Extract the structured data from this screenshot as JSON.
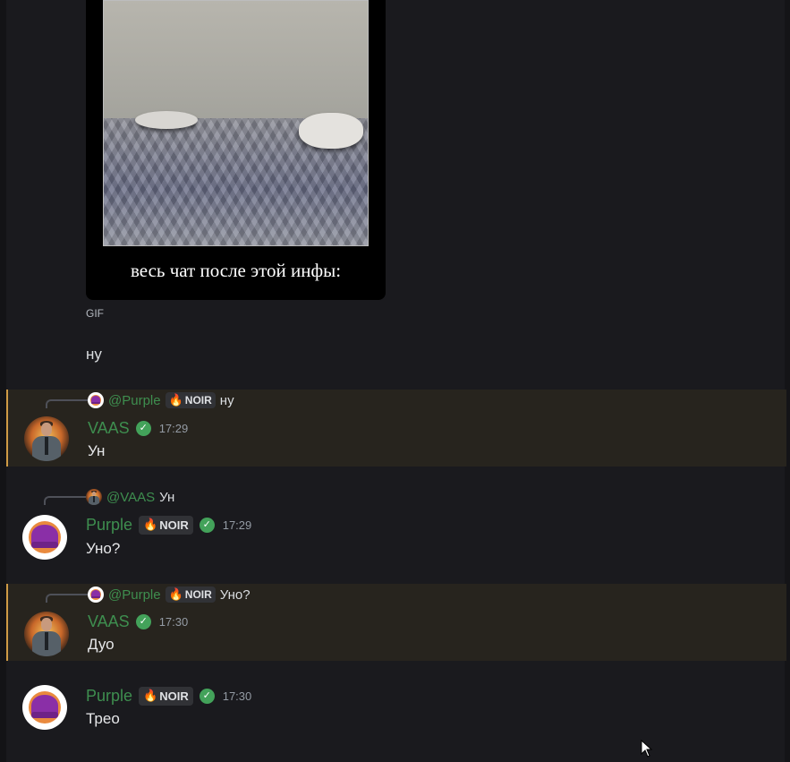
{
  "gif_message": {
    "caption": "весь чат после этой инфы:",
    "label": "GIF",
    "followup_text": "ну"
  },
  "messages": [
    {
      "reply_to": {
        "name": "@Purple",
        "tag": "NOIR",
        "text": "ну"
      },
      "author": "VAAS",
      "time": "17:29",
      "text": "Ун",
      "mention": true
    },
    {
      "reply_to": {
        "name": "@VAAS",
        "text": "Ун"
      },
      "author": "Purple",
      "tag": "NOIR",
      "time": "17:29",
      "text": "Уно?",
      "mention": false
    },
    {
      "reply_to": {
        "name": "@Purple",
        "tag": "NOIR",
        "text": "Уно?"
      },
      "author": "VAAS",
      "time": "17:30",
      "text": "Дуо",
      "mention": true
    },
    {
      "author": "Purple",
      "tag": "NOIR",
      "time": "17:30",
      "text": "Трео",
      "mention": false
    }
  ],
  "colors": {
    "background": "#1a1a1e",
    "mention_highlight": "#27241e",
    "mention_bar": "#cf9a45",
    "author_name": "#3e8e4f",
    "verified_badge": "#43a25a"
  },
  "icons": {
    "verified": "verified-check-icon",
    "tag": "flame-icon"
  }
}
